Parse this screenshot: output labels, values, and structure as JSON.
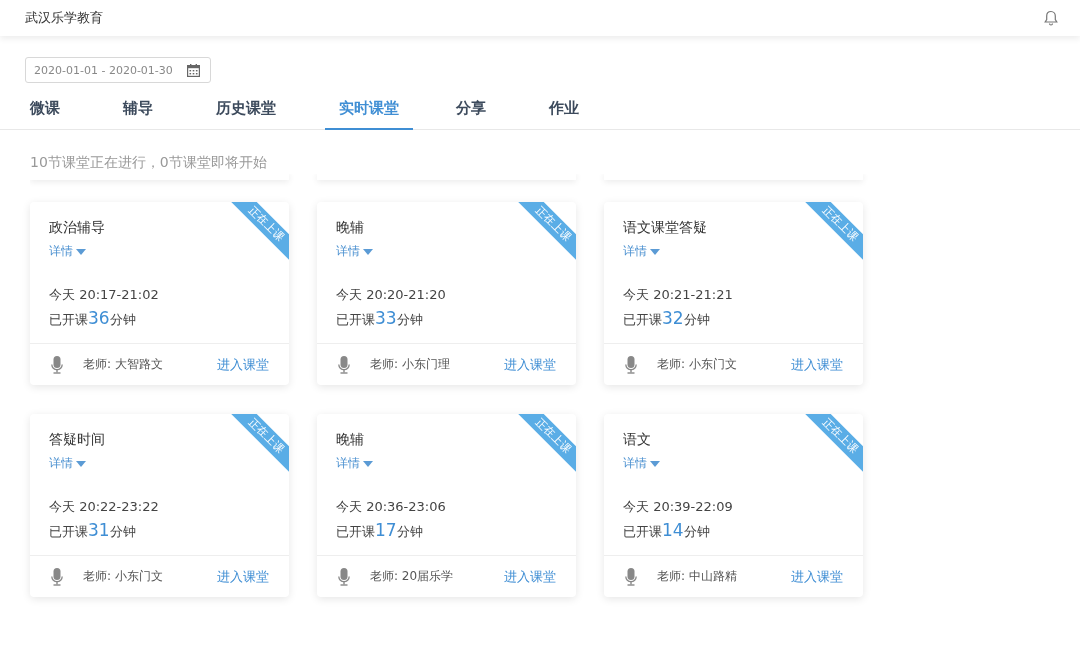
{
  "header": {
    "title": "武汉乐学教育"
  },
  "date_range": {
    "value": "2020-01-01 - 2020-01-30"
  },
  "tabs": [
    {
      "label": "微课",
      "selected": false
    },
    {
      "label": "辅导",
      "selected": false
    },
    {
      "label": "历史课堂",
      "selected": false
    },
    {
      "label": "实时课堂",
      "selected": true
    },
    {
      "label": "分享",
      "selected": false
    },
    {
      "label": "作业",
      "selected": false
    }
  ],
  "summary": "10节课堂正在进行，0节课堂即将开始",
  "cards": [
    {
      "title": "政治辅导",
      "details": "详情",
      "ribbon": "正在上课",
      "time": "今天 20:17-21:02",
      "elapsed_prefix": "已开课",
      "elapsed_minutes": "36",
      "elapsed_suffix": "分钟",
      "teacher": "老师: 大智路文",
      "enter": "进入课堂"
    },
    {
      "title": "晚辅",
      "details": "详情",
      "ribbon": "正在上课",
      "time": "今天 20:20-21:20",
      "elapsed_prefix": "已开课",
      "elapsed_minutes": "33",
      "elapsed_suffix": "分钟",
      "teacher": "老师: 小东门理",
      "enter": "进入课堂"
    },
    {
      "title": "语文课堂答疑",
      "details": "详情",
      "ribbon": "正在上课",
      "time": "今天 20:21-21:21",
      "elapsed_prefix": "已开课",
      "elapsed_minutes": "32",
      "elapsed_suffix": "分钟",
      "teacher": "老师: 小东门文",
      "enter": "进入课堂"
    },
    {
      "title": "答疑时间",
      "details": "详情",
      "ribbon": "正在上课",
      "time": "今天 20:22-23:22",
      "elapsed_prefix": "已开课",
      "elapsed_minutes": "31",
      "elapsed_suffix": "分钟",
      "teacher": "老师: 小东门文",
      "enter": "进入课堂"
    },
    {
      "title": "晚辅",
      "details": "详情",
      "ribbon": "正在上课",
      "time": "今天 20:36-23:06",
      "elapsed_prefix": "已开课",
      "elapsed_minutes": "17",
      "elapsed_suffix": "分钟",
      "teacher": "老师: 20届乐学",
      "enter": "进入课堂"
    },
    {
      "title": "语文",
      "details": "详情",
      "ribbon": "正在上课",
      "time": "今天 20:39-22:09",
      "elapsed_prefix": "已开课",
      "elapsed_minutes": "14",
      "elapsed_suffix": "分钟",
      "teacher": "老师: 中山路精",
      "enter": "进入课堂"
    }
  ]
}
